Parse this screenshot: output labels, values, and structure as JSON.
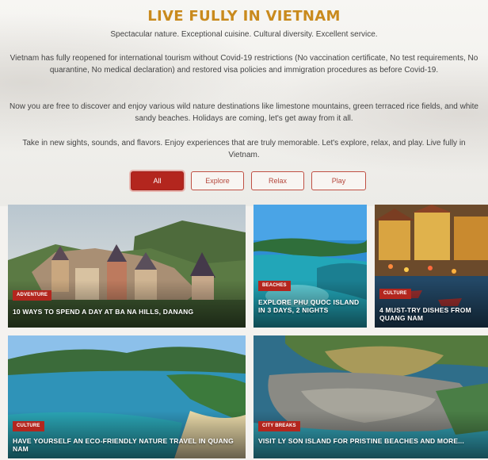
{
  "header": {
    "title": "LIVE FULLY IN VIETNAM",
    "subtitle": "Spectacular nature. Exceptional cuisine. Cultural diversity. Excellent service.",
    "paragraphs": [
      "Vietnam has fully reopened for international tourism without Covid-19 restrictions (No vaccination certificate, No test requirements, No quarantine, No medical declaration) and restored visa policies and immigration procedures as before Covid-19.",
      "Now you are free to discover and enjoy various wild nature destinations like limestone mountains, green terraced rice fields, and white sandy beaches. Holidays are coming, let's get away from it all.",
      "Take in new sights, sounds, and flavors. Enjoy experiences that are truly memorable. Let's explore, relax, and play. Live fully in Vietnam."
    ]
  },
  "filters": [
    {
      "label": "All",
      "active": true
    },
    {
      "label": "Explore",
      "active": false
    },
    {
      "label": "Relax",
      "active": false
    },
    {
      "label": "Play",
      "active": false
    }
  ],
  "cards": [
    {
      "tag": "ADVENTURE",
      "title": "10 WAYS TO SPEND A DAY AT BA NA HILLS, DANANG"
    },
    {
      "tag": "BEACHES",
      "title": "EXPLORE PHU QUOC ISLAND IN 3 DAYS, 2 NIGHTS"
    },
    {
      "tag": "CULTURE",
      "title": "4 MUST-TRY DISHES FROM QUANG NAM"
    },
    {
      "tag": "CULTURE",
      "title": "HAVE YOURSELF AN ECO-FRIENDLY NATURE TRAVEL IN QUANG NAM"
    },
    {
      "tag": "CITY BREAKS",
      "title": "VISIT LY SON ISLAND FOR PRISTINE BEACHES AND MORE..."
    }
  ],
  "colors": {
    "title": "#c98a1d",
    "accent": "#b3261e"
  }
}
